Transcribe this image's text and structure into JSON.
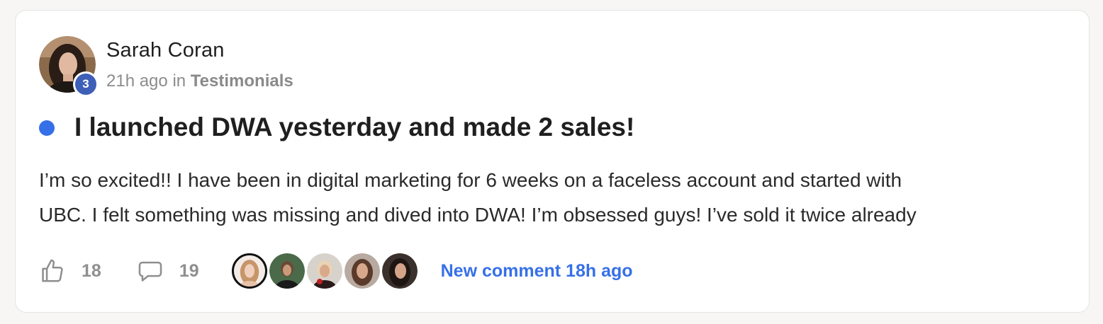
{
  "post": {
    "author": "Sarah Coran",
    "level": "3",
    "time": "21h ago",
    "in_label": "in",
    "category": "Testimonials",
    "title": "I launched DWA yesterday and made 2 sales!",
    "body_line1": "I’m so excited!! I have been in digital marketing for 6 weeks on a faceless account and started with",
    "body_line2": "UBC. I felt something was missing and dived into DWA! I’m obsessed guys! I’ve sold it twice already",
    "unread": true
  },
  "actions": {
    "likes": "18",
    "comments": "19",
    "new_comment": "New comment 18h ago"
  },
  "colors": {
    "accent": "#3670e8",
    "level_badge": "#3e5fb8",
    "muted_text": "#8c8c8c"
  },
  "icons": {
    "like": "thumbs-up-icon",
    "comment": "comment-bubble-icon"
  }
}
